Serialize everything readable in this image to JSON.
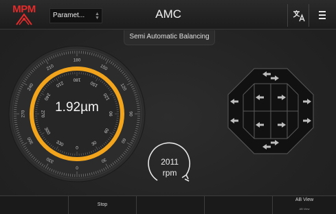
{
  "header": {
    "logo_text": "MPM",
    "select_value": "Paramet...",
    "title": "AMC",
    "subtitle": "Semi Automatic Balancing",
    "language_icon": "translate-icon",
    "menu_icon": "hamburger-menu-icon"
  },
  "gauge": {
    "value": "1.92µm",
    "outer_ticks": [
      "180",
      "150",
      "120",
      "90",
      "60",
      "30",
      "0",
      "330",
      "300",
      "270",
      "240",
      "210"
    ],
    "inner_ticks": [
      "0",
      "30",
      "60",
      "90",
      "120",
      "150",
      "180",
      "210",
      "240",
      "270",
      "300",
      "330"
    ],
    "accent_color": "#f2a51c"
  },
  "rpm": {
    "value": "2011",
    "unit": "rpm"
  },
  "pad": {
    "icon": "direction-arrow-icon"
  },
  "footer": {
    "buttons": [
      "",
      "Stop",
      "",
      "",
      "AB View",
      ""
    ],
    "ab_view_sub": "AB View"
  }
}
